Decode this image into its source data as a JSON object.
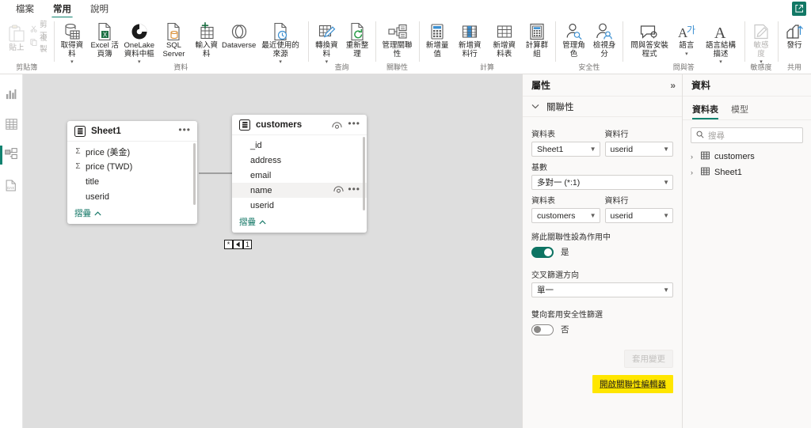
{
  "app": {
    "tabs": [
      {
        "label": "檔案",
        "active": false
      },
      {
        "label": "常用",
        "active": true
      },
      {
        "label": "說明",
        "active": false
      }
    ],
    "share_icon": "share-export-icon"
  },
  "ribbon": {
    "groups": [
      {
        "label": "剪貼簿",
        "buttons": [
          {
            "label": "貼上",
            "icon": "paste-icon",
            "dimmed": true
          },
          {
            "label": "剪下",
            "icon": "scissors-icon",
            "dimmed": true,
            "small": true
          },
          {
            "label": "複製",
            "icon": "copy-icon",
            "dimmed": true,
            "small": true
          }
        ]
      },
      {
        "label": "資料",
        "buttons": [
          {
            "label": "取得資料",
            "icon": "get-data-icon",
            "chevron": true
          },
          {
            "label": "Excel 活頁簿",
            "icon": "excel-icon"
          },
          {
            "label": "OneLake 資料中樞",
            "icon": "onelake-icon",
            "chevron": true
          },
          {
            "label": "SQL Server",
            "icon": "sql-server-icon"
          },
          {
            "label": "輸入資料",
            "icon": "enter-data-icon"
          },
          {
            "label": "Dataverse",
            "icon": "dataverse-icon"
          },
          {
            "label": "最近使用的來源",
            "icon": "recent-sources-icon",
            "chevron": true
          }
        ]
      },
      {
        "label": "查詢",
        "buttons": [
          {
            "label": "轉換資料",
            "icon": "transform-data-icon",
            "chevron": true
          },
          {
            "label": "重新整理",
            "icon": "refresh-icon"
          }
        ]
      },
      {
        "label": "關聯性",
        "buttons": [
          {
            "label": "管理關聯性",
            "icon": "manage-relationships-icon"
          }
        ]
      },
      {
        "label": "計算",
        "buttons": [
          {
            "label": "新增量值",
            "icon": "new-measure-icon"
          },
          {
            "label": "新增資料行",
            "icon": "new-column-icon"
          },
          {
            "label": "新增資料表",
            "icon": "new-table-icon"
          },
          {
            "label": "計算群組",
            "icon": "calculation-group-icon"
          }
        ]
      },
      {
        "label": "安全性",
        "buttons": [
          {
            "label": "管理角色",
            "icon": "manage-roles-icon"
          },
          {
            "label": "檢視身分",
            "icon": "view-as-icon"
          }
        ]
      },
      {
        "label": "問與答",
        "buttons": [
          {
            "label": "問與答安裝程式",
            "icon": "qna-setup-icon"
          },
          {
            "label": "語言",
            "icon": "language-icon",
            "chevron": true
          },
          {
            "label": "語言結構描述",
            "icon": "linguistic-schema-icon",
            "chevron": true
          }
        ]
      },
      {
        "label": "敏感度",
        "buttons": [
          {
            "label": "敏感度",
            "icon": "sensitivity-icon",
            "chevron": true,
            "dimmed": true
          }
        ]
      },
      {
        "label": "共用",
        "buttons": [
          {
            "label": "發行",
            "icon": "publish-icon"
          }
        ]
      }
    ]
  },
  "leftnav": {
    "items": [
      {
        "name": "report-view",
        "icon": "bar-chart-icon",
        "active": false
      },
      {
        "name": "table-view",
        "icon": "table-grid-icon",
        "active": false
      },
      {
        "name": "model-view",
        "icon": "model-diagram-icon",
        "active": true
      },
      {
        "name": "dax-query-view",
        "icon": "dax-query-icon",
        "active": false
      }
    ]
  },
  "canvas": {
    "tables": [
      {
        "name": "Sheet1",
        "has_eye": false,
        "fields": [
          {
            "name": "price (美金)",
            "aggregate": true
          },
          {
            "name": "price (TWD)",
            "aggregate": true
          },
          {
            "name": "title",
            "aggregate": false
          },
          {
            "name": "userid",
            "aggregate": false
          }
        ],
        "collapse_label": "摺疊"
      },
      {
        "name": "customers",
        "has_eye": true,
        "fields": [
          {
            "name": "_id",
            "aggregate": false
          },
          {
            "name": "address",
            "aggregate": false
          },
          {
            "name": "email",
            "aggregate": false
          },
          {
            "name": "name",
            "aggregate": false,
            "highlighted": true
          },
          {
            "name": "userid",
            "aggregate": false
          }
        ],
        "collapse_label": "摺疊"
      }
    ],
    "relationship": {
      "from_cardinality": "*",
      "to_cardinality": "1",
      "direction_icon": "left-arrow-filter-icon"
    }
  },
  "properties": {
    "title": "屬性",
    "collapse_icon": "double-chevron-right-icon",
    "section": {
      "label": "關聯性",
      "expand_icon": "chevron-down-icon"
    },
    "from_table_label": "資料表",
    "from_table_value": "Sheet1",
    "from_column_label": "資料行",
    "from_column_value": "userid",
    "cardinality_label": "基數",
    "cardinality_value": "多對一 (*:1)",
    "to_table_label": "資料表",
    "to_table_value": "customers",
    "to_column_label": "資料行",
    "to_column_value": "userid",
    "active_label": "將此關聯性設為作用中",
    "active_toggle_value": "是",
    "active_toggle_on": true,
    "cross_filter_label": "交叉篩選方向",
    "cross_filter_value": "單一",
    "bidirectional_label": "雙向套用安全性篩選",
    "bidirectional_toggle_value": "否",
    "bidirectional_toggle_on": false,
    "apply_button": "套用變更",
    "open_editor_button": "開啟關聯性編輯器",
    "highlight_color": "#ffe600"
  },
  "datapane": {
    "title": "資料",
    "tabs": [
      {
        "label": "資料表",
        "active": true
      },
      {
        "label": "模型",
        "active": false
      }
    ],
    "search_placeholder": "搜尋",
    "search_icon": "search-icon",
    "tree": [
      {
        "label": "customers",
        "icon": "table-icon"
      },
      {
        "label": "Sheet1",
        "icon": "table-icon"
      }
    ]
  },
  "colors": {
    "accent": "#118270",
    "canvas_bg": "#dedede",
    "pane_bg": "#faf9f8",
    "highlight": "#ffe600"
  }
}
